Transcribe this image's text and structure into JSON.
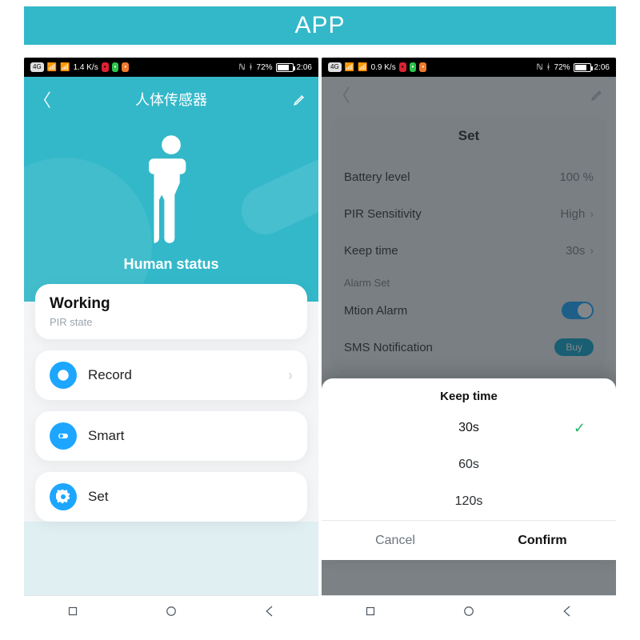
{
  "banner": "APP",
  "statusbar": {
    "battery_pct": "72%",
    "time": "2:06",
    "net_rate": "1.4 K/s",
    "net_mode": "4G"
  },
  "left": {
    "title": "人体传感器",
    "hero_caption": "Human status",
    "status_card": {
      "heading": "Working",
      "sub": "PIR state"
    },
    "rows": {
      "record": "Record",
      "smart": "Smart",
      "set": "Set"
    }
  },
  "right": {
    "panel_title": "Set",
    "rows": {
      "battery_k": "Battery level",
      "battery_v": "100 %",
      "pir_k": "PIR Sensitivity",
      "pir_v": "High",
      "keep_k": "Keep time",
      "keep_v": "30s",
      "alarm_section": "Alarm Set",
      "motion_k": "Mtion Alarm",
      "sms_k": "SMS Notification",
      "sms_v": "Buy"
    },
    "sheet": {
      "title": "Keep time",
      "opt1": "30s",
      "opt2": "60s",
      "opt3": "120s",
      "cancel": "Cancel",
      "confirm": "Confirm"
    }
  }
}
